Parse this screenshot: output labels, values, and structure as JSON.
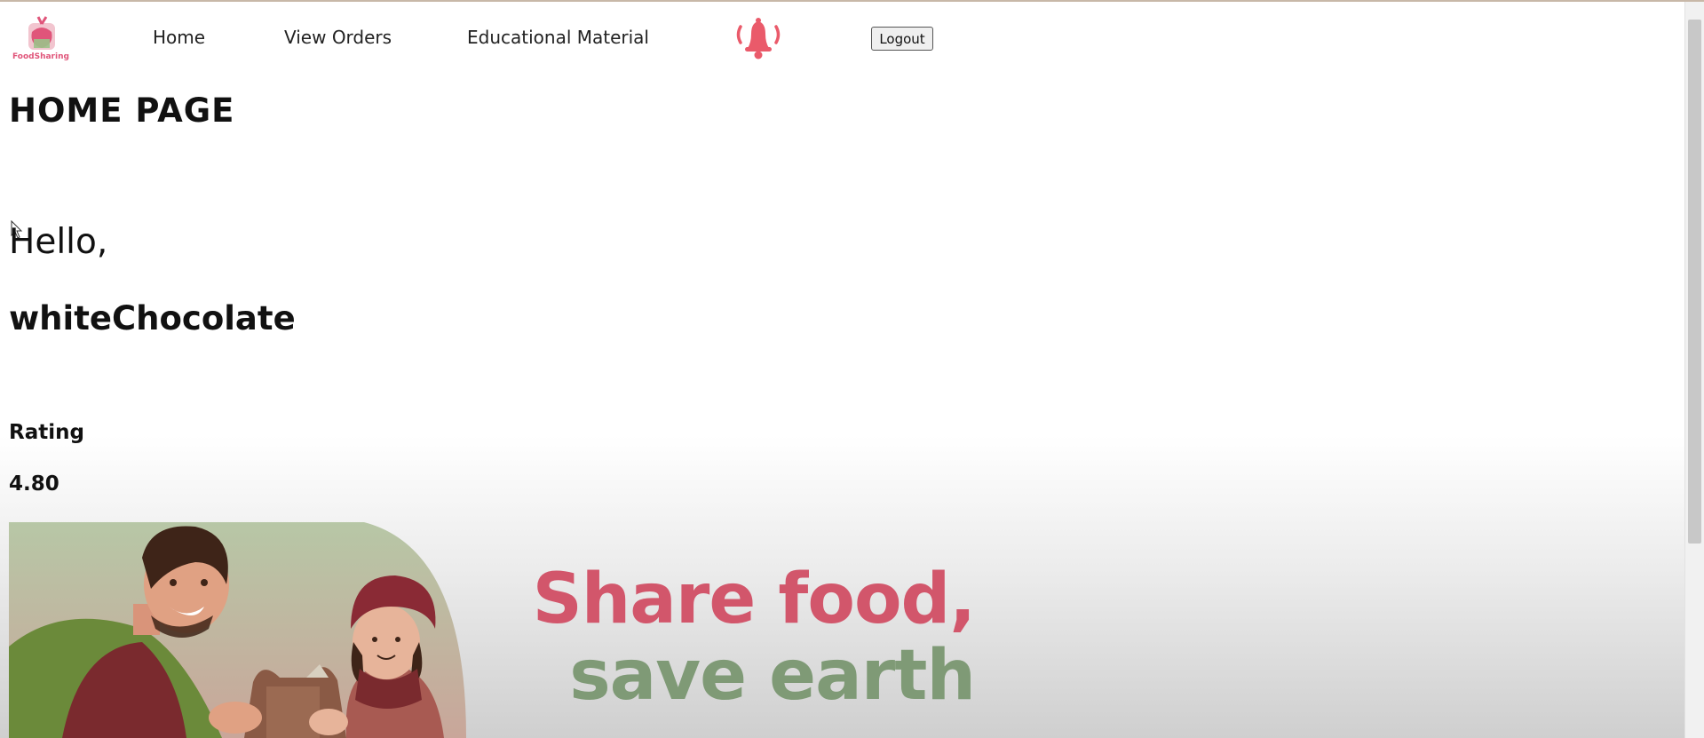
{
  "nav": {
    "logo_text": "FoodSharing",
    "links": [
      {
        "label": "Home"
      },
      {
        "label": "View Orders"
      },
      {
        "label": "Educational Material"
      }
    ],
    "logout_label": "Logout"
  },
  "main": {
    "page_title": "HOME  PAGE",
    "greeting": "Hello,",
    "username": "whiteChocolate",
    "rating_label": "Rating",
    "rating_value": "4.80"
  },
  "banner": {
    "line1": "Share food,",
    "line2": "save earth"
  },
  "icons": {
    "bell": "bell-icon",
    "logo": "apple-logo-icon",
    "cursor": "mouse-cursor-icon"
  },
  "colors": {
    "accent_pink": "#d2566b",
    "accent_green": "#7f9a76",
    "bell": "#ea5a6a"
  }
}
